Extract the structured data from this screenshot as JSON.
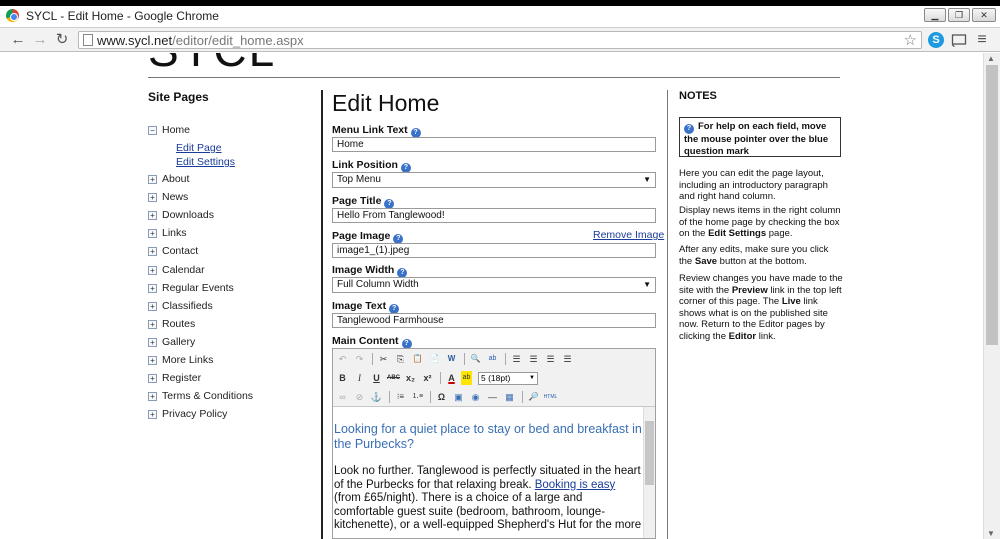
{
  "window": {
    "title": "SYCL - Edit Home - Google Chrome",
    "buttons": {
      "minimize": "▁",
      "restore": "❐",
      "close": "✕"
    }
  },
  "browser": {
    "url_host": "www.sycl.net",
    "url_path": "/editor/edit_home.aspx",
    "back_icon": "←",
    "forward_icon": "→",
    "reload_icon": "↻",
    "star_icon": "☆",
    "menu_icon": "≡"
  },
  "site": {
    "logo": "SYCL"
  },
  "sidebar": {
    "heading": "Site Pages",
    "items": [
      {
        "label": "Home",
        "box": "−"
      },
      {
        "label": "About",
        "box": "+"
      },
      {
        "label": "News",
        "box": "+"
      },
      {
        "label": "Downloads",
        "box": "+"
      },
      {
        "label": "Links",
        "box": "+"
      },
      {
        "label": "Contact",
        "box": "+"
      },
      {
        "label": "Calendar",
        "box": "+"
      },
      {
        "label": "Regular Events",
        "box": "+"
      },
      {
        "label": "Classifieds",
        "box": "+"
      },
      {
        "label": "Routes",
        "box": "+"
      },
      {
        "label": "Gallery",
        "box": "+"
      },
      {
        "label": "More Links",
        "box": "+"
      },
      {
        "label": "Register",
        "box": "+"
      },
      {
        "label": "Terms & Conditions",
        "box": "+"
      },
      {
        "label": "Privacy Policy",
        "box": "+"
      }
    ],
    "home_sub": [
      "Edit Page",
      "Edit Settings"
    ]
  },
  "form": {
    "heading": "Edit Home",
    "help_glyph": "?",
    "menu_link_text": {
      "label": "Menu Link Text",
      "value": "Home"
    },
    "link_position": {
      "label": "Link Position",
      "value": "Top Menu"
    },
    "page_title": {
      "label": "Page Title",
      "value": "Hello From Tanglewood!"
    },
    "page_image": {
      "label": "Page Image",
      "value": "image1_(1).jpeg",
      "remove": "Remove Image"
    },
    "image_width": {
      "label": "Image Width",
      "value": "Full Column Width"
    },
    "image_text": {
      "label": "Image Text",
      "value": "Tanglewood Farmhouse"
    },
    "main_content": {
      "label": "Main Content"
    },
    "select_arrow": "▼"
  },
  "editor": {
    "toolbar": {
      "undo": "↶",
      "redo": "↷",
      "cut": "✂",
      "copy": "⎘",
      "paste": "📋",
      "paste_text": "📄",
      "paste_word": "W",
      "find": "🔍",
      "replace": "ab",
      "align_left": "☰",
      "align_center": "☰",
      "align_right": "☰",
      "justify": "☰",
      "bold": "B",
      "italic": "I",
      "underline": "U",
      "strike": "ABC",
      "subscript": "x₂",
      "superscript": "x²",
      "font_color": "A",
      "highlight": "ab",
      "font_size": "5 (18pt)",
      "link": "∞",
      "unlink": "⊘",
      "anchor": "⚓",
      "bullets": "⁝≡",
      "numbers": "⒈≡",
      "special_char": "Ω",
      "image": "▣",
      "flash": "◉",
      "hr": "—",
      "table": "▦",
      "preview": "🔎",
      "html": "HTML"
    },
    "heading_text": "Looking for a quiet place to stay or bed and breakfast in the Purbecks?",
    "para_start": "Look no further. Tanglewood is perfectly situated in the heart of the Purbecks for that relaxing break. ",
    "para_link": "Booking is easy",
    "para_end": " (from £65/night). There is a choice of a large and comfortable guest suite (bedroom, bathroom, lounge-kitchenette), or a well-equipped Shepherd's Hut for the more"
  },
  "notes": {
    "heading": "NOTES",
    "help_box": "For help on each field, move the mouse pointer over the blue question mark",
    "p1": "Here you can edit the page layout, including an introductory paragraph and right hand column.",
    "p2a": "Display news items in the right column of the home page by checking the box on the ",
    "p2b": "Edit Settings",
    "p2c": " page.",
    "p3a": "After any edits, make sure you click the ",
    "p3b": "Save",
    "p3c": " button at the bottom.",
    "p4a": "Review changes you have made to the site with the ",
    "p4b": "Preview",
    "p4c": " link in the top left corner of this page. The ",
    "p4d": "Live",
    "p4e": " link shows what is on the published site now. Return to the Editor pages by clicking the ",
    "p4f": "Editor",
    "p4g": " link."
  }
}
